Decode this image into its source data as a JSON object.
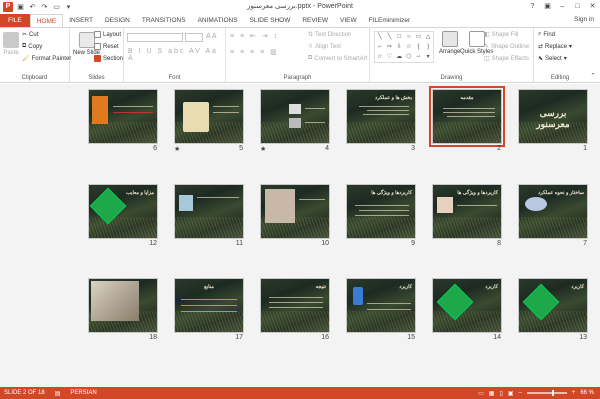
{
  "window": {
    "title": "بررسی معرسنور.pptx - PowerPoint"
  },
  "tabs": [
    "FILE",
    "HOME",
    "INSERT",
    "DESIGN",
    "TRANSITIONS",
    "ANIMATIONS",
    "SLIDE SHOW",
    "REVIEW",
    "VIEW",
    "FILEminimizer"
  ],
  "account": {
    "signin": "Sign in"
  },
  "ribbon": {
    "clipboard": {
      "paste": "Paste",
      "cut": "Cut",
      "copy": "Copy",
      "format_painter": "Format Painter",
      "label": "Clipboard"
    },
    "slides": {
      "new_slide": "New Slide",
      "layout": "Layout",
      "reset": "Reset",
      "section": "Section",
      "label": "Slides"
    },
    "font": {
      "label": "Font"
    },
    "paragraph": {
      "text_direction": "Text Direction",
      "align_text": "Align Text",
      "convert_smartart": "Convert to SmartArt",
      "label": "Paragraph"
    },
    "drawing": {
      "arrange": "Arrange",
      "quick_styles": "Quick Styles",
      "shape_fill": "Shape Fill",
      "shape_outline": "Shape Outline",
      "shape_effects": "Shape Effects",
      "label": "Drawing"
    },
    "editing": {
      "find": "Find",
      "replace": "Replace",
      "select": "Select",
      "label": "Editing"
    }
  },
  "slides": [
    {
      "num": "1",
      "title": "بررسی معرسنور",
      "star": ""
    },
    {
      "num": "2",
      "title": "مقدمه",
      "star": ""
    },
    {
      "num": "3",
      "title": "بخش ها و عملکرد",
      "star": ""
    },
    {
      "num": "4",
      "title": "",
      "star": "★"
    },
    {
      "num": "5",
      "title": "",
      "star": "★"
    },
    {
      "num": "6",
      "title": "",
      "star": ""
    },
    {
      "num": "7",
      "title": "ساختار و نحوه عملکرد",
      "star": ""
    },
    {
      "num": "8",
      "title": "کاربردها و ویژگی ها",
      "star": ""
    },
    {
      "num": "9",
      "title": "کاربردها و ویژگی ها",
      "star": ""
    },
    {
      "num": "10",
      "title": "",
      "star": ""
    },
    {
      "num": "11",
      "title": "",
      "star": ""
    },
    {
      "num": "12",
      "title": "مزایا و معایب",
      "star": ""
    },
    {
      "num": "13",
      "title": "کاربرد",
      "star": ""
    },
    {
      "num": "14",
      "title": "کاربرد",
      "star": ""
    },
    {
      "num": "15",
      "title": "کاربرد",
      "star": ""
    },
    {
      "num": "16",
      "title": "نتیجه",
      "star": ""
    },
    {
      "num": "17",
      "title": "منابع",
      "star": ""
    },
    {
      "num": "18",
      "title": "",
      "star": ""
    }
  ],
  "status": {
    "slide": "SLIDE 2 OF 18",
    "language": "PERSIAN",
    "zoom": "66 %",
    "zoom_level": 0.66
  },
  "colors": {
    "accent": "#d24726"
  }
}
